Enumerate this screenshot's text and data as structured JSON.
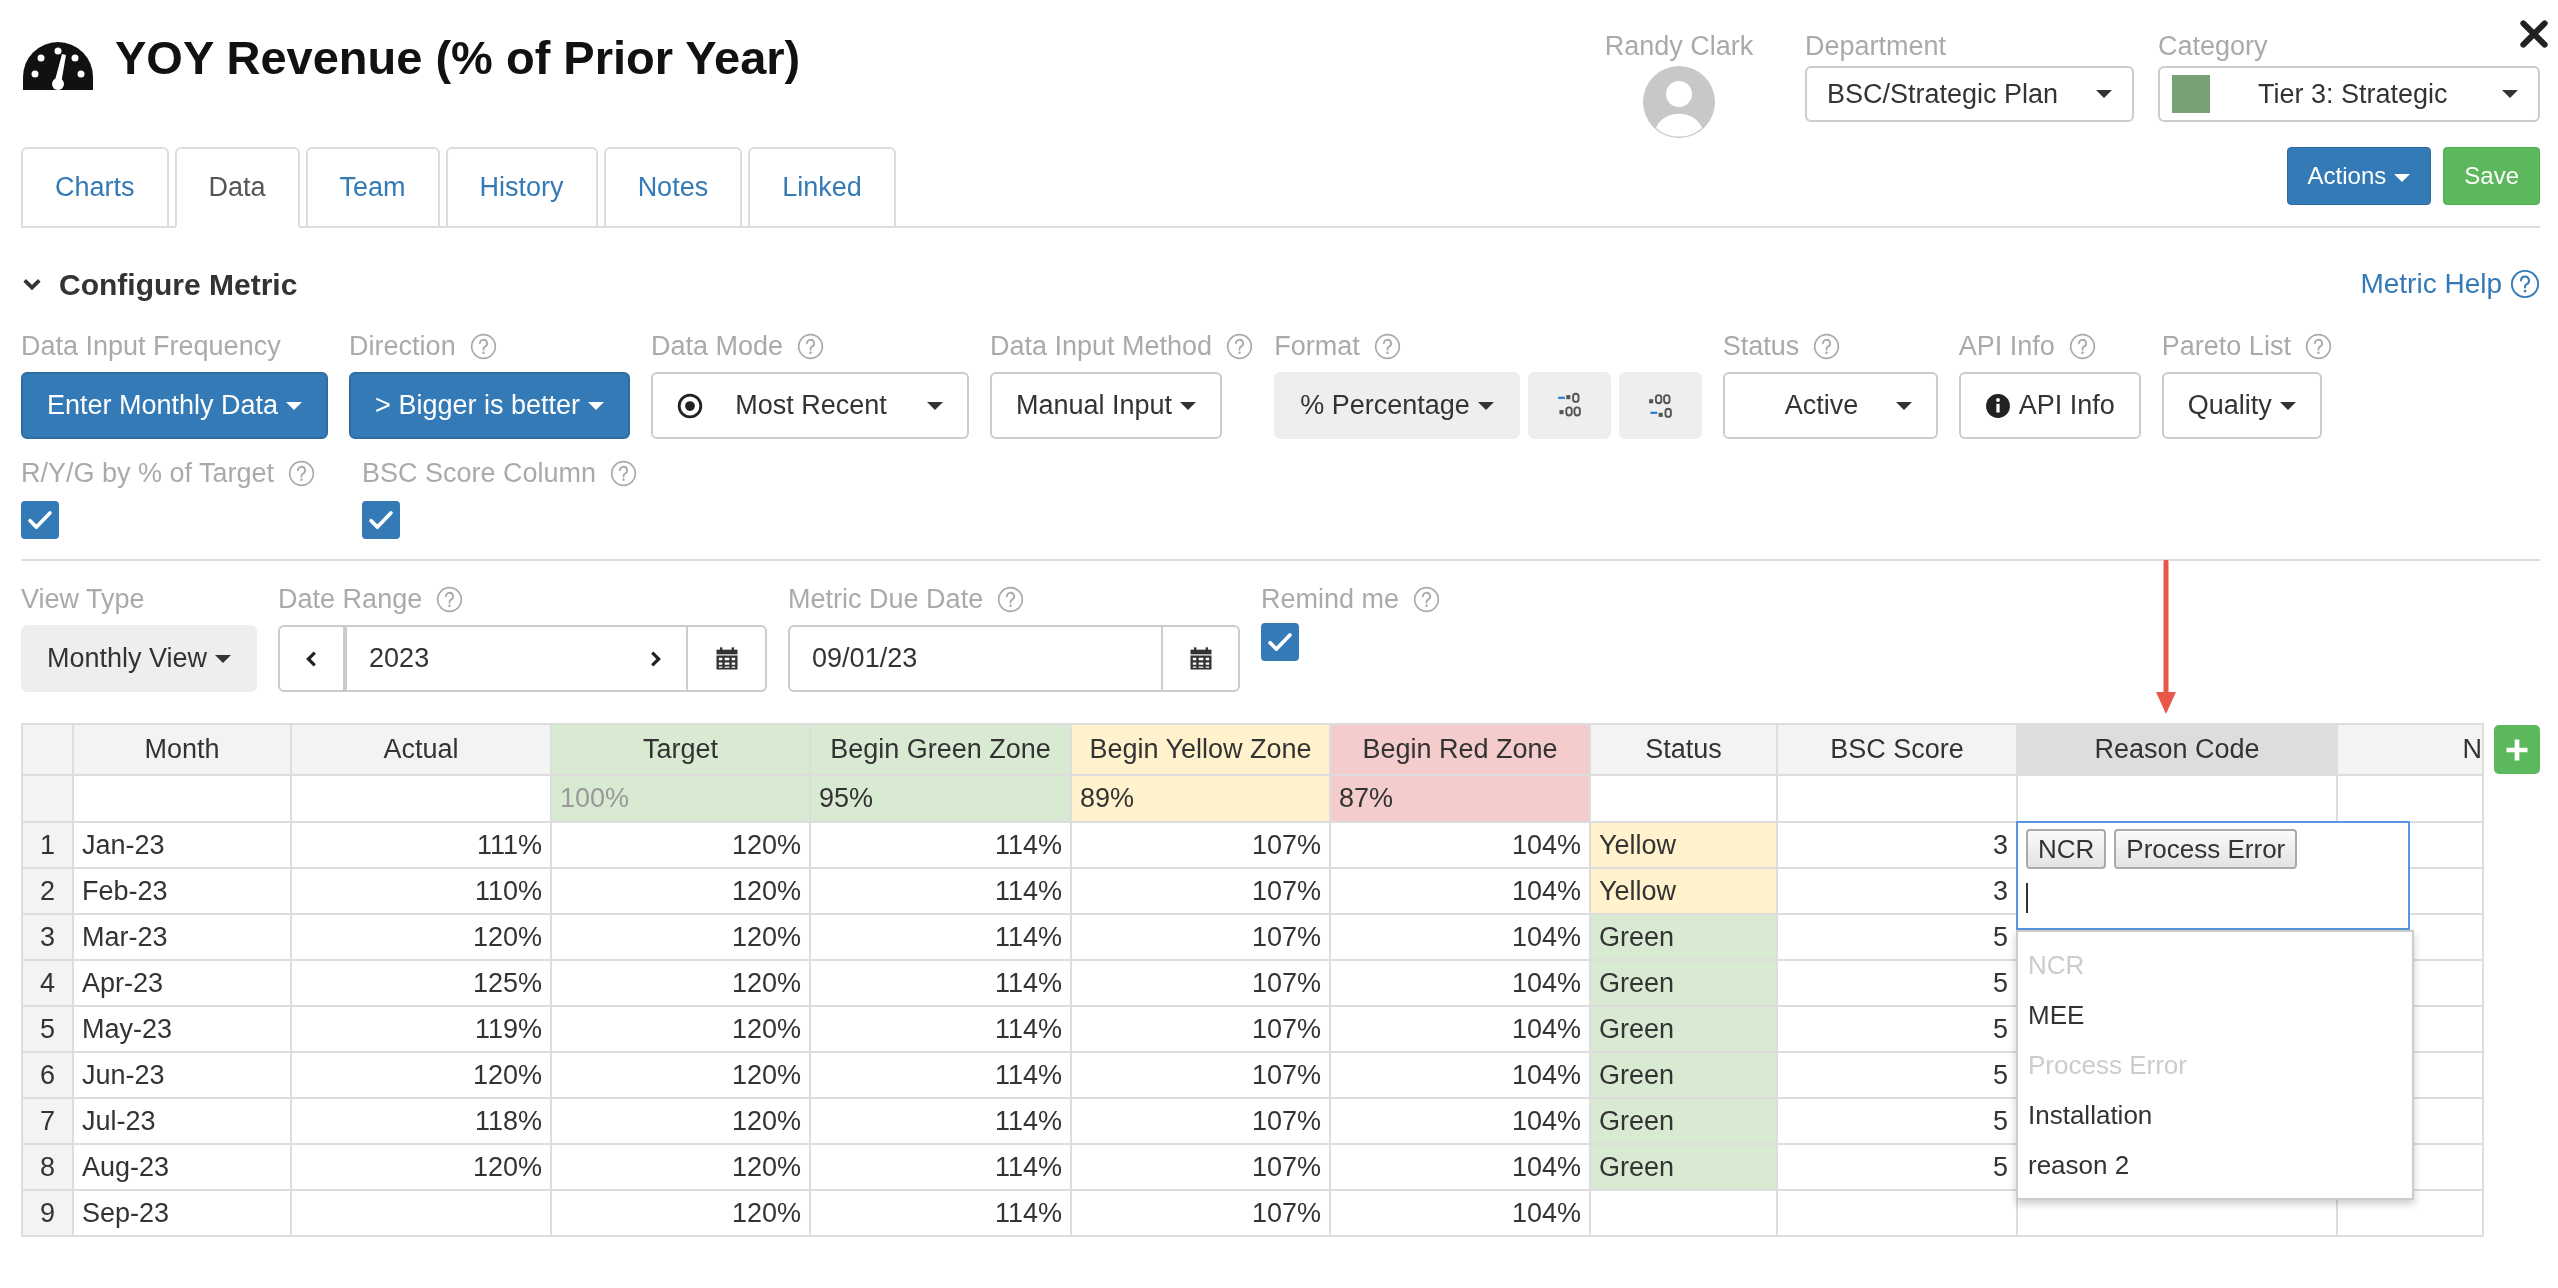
{
  "title": "YOY Revenue (% of Prior Year)",
  "owner": {
    "name": "Randy Clark"
  },
  "selectors": [
    {
      "label": "Department",
      "value": "BSC/Strategic Plan",
      "swatch": false
    },
    {
      "label": "Category",
      "value": "Tier 3: Strategic",
      "swatch": true
    }
  ],
  "header_buttons": [
    {
      "label": "Actions",
      "kind": "dropdown"
    },
    {
      "label": "Save",
      "kind": "save"
    }
  ],
  "tabs": [
    {
      "label": "Charts",
      "selected": false
    },
    {
      "label": "Data",
      "selected": true
    },
    {
      "label": "Team",
      "selected": false
    },
    {
      "label": "History",
      "selected": false
    },
    {
      "label": "Notes",
      "selected": false
    },
    {
      "label": "Linked",
      "selected": false
    }
  ],
  "section": {
    "title": "Configure Metric",
    "expanded": true,
    "help_link": "Metric Help"
  },
  "config_rows": [
    [
      {
        "label": "Data Input Frequency",
        "help": false,
        "kind": "primary",
        "value": "Enter Monthly Data"
      },
      {
        "label": "Direction",
        "help": true,
        "kind": "primary",
        "value": "> Bigger is better"
      },
      {
        "label": "Data Mode",
        "help": true,
        "kind": "mode",
        "value": "Most Recent"
      },
      {
        "label": "Data Input Method",
        "help": true,
        "kind": "outline",
        "value": "Manual Input"
      },
      {
        "label": "Format",
        "help": true,
        "kind": "format",
        "value": "% Percentage"
      },
      {
        "label": "Status",
        "help": true,
        "kind": "select",
        "value": "Active"
      },
      {
        "label": "API Info",
        "help": true,
        "kind": "info",
        "value": "API Info"
      },
      {
        "label": "Pareto List",
        "help": true,
        "kind": "outline",
        "value": "Quality"
      }
    ],
    [
      {
        "label": "R/Y/G by % of Target",
        "help": true,
        "kind": "checkbox",
        "checked": true
      },
      {
        "label": "BSC Score Column",
        "help": true,
        "kind": "checkbox",
        "checked": true
      }
    ]
  ],
  "view_controls": [
    {
      "label": "View Type",
      "help": false,
      "kind": "gray",
      "value": "Monthly View"
    },
    {
      "label": "Date Range",
      "help": true,
      "kind": "range",
      "value": "2023"
    },
    {
      "label": "Metric Due Date",
      "help": true,
      "kind": "date",
      "value": "09/01/23"
    },
    {
      "label": "Remind me",
      "help": true,
      "kind": "checkbox",
      "checked": true
    }
  ],
  "table": {
    "columns": [
      {
        "label": "Month",
        "kind": "text",
        "selected": false
      },
      {
        "label": "Actual",
        "kind": "number",
        "selected": false
      },
      {
        "label": "Target",
        "kind": "number",
        "color": "#d9ead3",
        "selected": false,
        "threshold": {
          "text": "100%",
          "disabled": true
        }
      },
      {
        "label": "Begin Green Zone",
        "kind": "number",
        "color": "#d9ead3",
        "selected": false,
        "threshold": {
          "text": "95%",
          "disabled": false
        }
      },
      {
        "label": "Begin Yellow Zone",
        "kind": "number",
        "color": "#fff2cc",
        "selected": false,
        "threshold": {
          "text": "89%",
          "disabled": false
        }
      },
      {
        "label": "Begin Red Zone",
        "kind": "number",
        "color": "#f4cccc",
        "selected": false,
        "threshold": {
          "text": "87%",
          "disabled": false
        }
      },
      {
        "label": "Status",
        "kind": "status",
        "selected": false
      },
      {
        "label": "BSC Score",
        "kind": "number",
        "selected": false
      },
      {
        "label": "Reason Code",
        "kind": "tags",
        "selected": true
      },
      {
        "label": "N",
        "kind": "cut",
        "selected": false
      }
    ],
    "rows": [
      {
        "number": "1",
        "color": "#fff2cc",
        "cells": [
          "Jan-23",
          "111%",
          "120%",
          "114%",
          "107%",
          "104%",
          "Yellow",
          "3"
        ]
      },
      {
        "number": "2",
        "color": "#fff2cc",
        "cells": [
          "Feb-23",
          "110%",
          "120%",
          "114%",
          "107%",
          "104%",
          "Yellow",
          "3"
        ]
      },
      {
        "number": "3",
        "color": "#d9ead3",
        "cells": [
          "Mar-23",
          "120%",
          "120%",
          "114%",
          "107%",
          "104%",
          "Green",
          "5"
        ]
      },
      {
        "number": "4",
        "color": "#d9ead3",
        "cells": [
          "Apr-23",
          "125%",
          "120%",
          "114%",
          "107%",
          "104%",
          "Green",
          "5"
        ]
      },
      {
        "number": "5",
        "color": "#d9ead3",
        "cells": [
          "May-23",
          "119%",
          "120%",
          "114%",
          "107%",
          "104%",
          "Green",
          "5"
        ]
      },
      {
        "number": "6",
        "color": "#d9ead3",
        "cells": [
          "Jun-23",
          "120%",
          "120%",
          "114%",
          "107%",
          "104%",
          "Green",
          "5"
        ]
      },
      {
        "number": "7",
        "color": "#d9ead3",
        "cells": [
          "Jul-23",
          "118%",
          "120%",
          "114%",
          "107%",
          "104%",
          "Green",
          "5"
        ]
      },
      {
        "number": "8",
        "color": "#d9ead3",
        "cells": [
          "Aug-23",
          "120%",
          "120%",
          "114%",
          "107%",
          "104%",
          "Green",
          "5"
        ]
      },
      {
        "number": "9",
        "cells": [
          "Sep-23",
          null,
          "120%",
          "114%",
          "107%",
          "104%",
          null,
          null
        ]
      }
    ],
    "reason_editor": {
      "tags": [
        "NCR",
        "Process Error"
      ],
      "options": [
        {
          "label": "NCR",
          "disabled": true
        },
        {
          "label": "MEE",
          "disabled": false
        },
        {
          "label": "Process Error",
          "disabled": true
        },
        {
          "label": "Installation",
          "disabled": false
        },
        {
          "label": "reason 2",
          "disabled": false
        }
      ]
    }
  }
}
